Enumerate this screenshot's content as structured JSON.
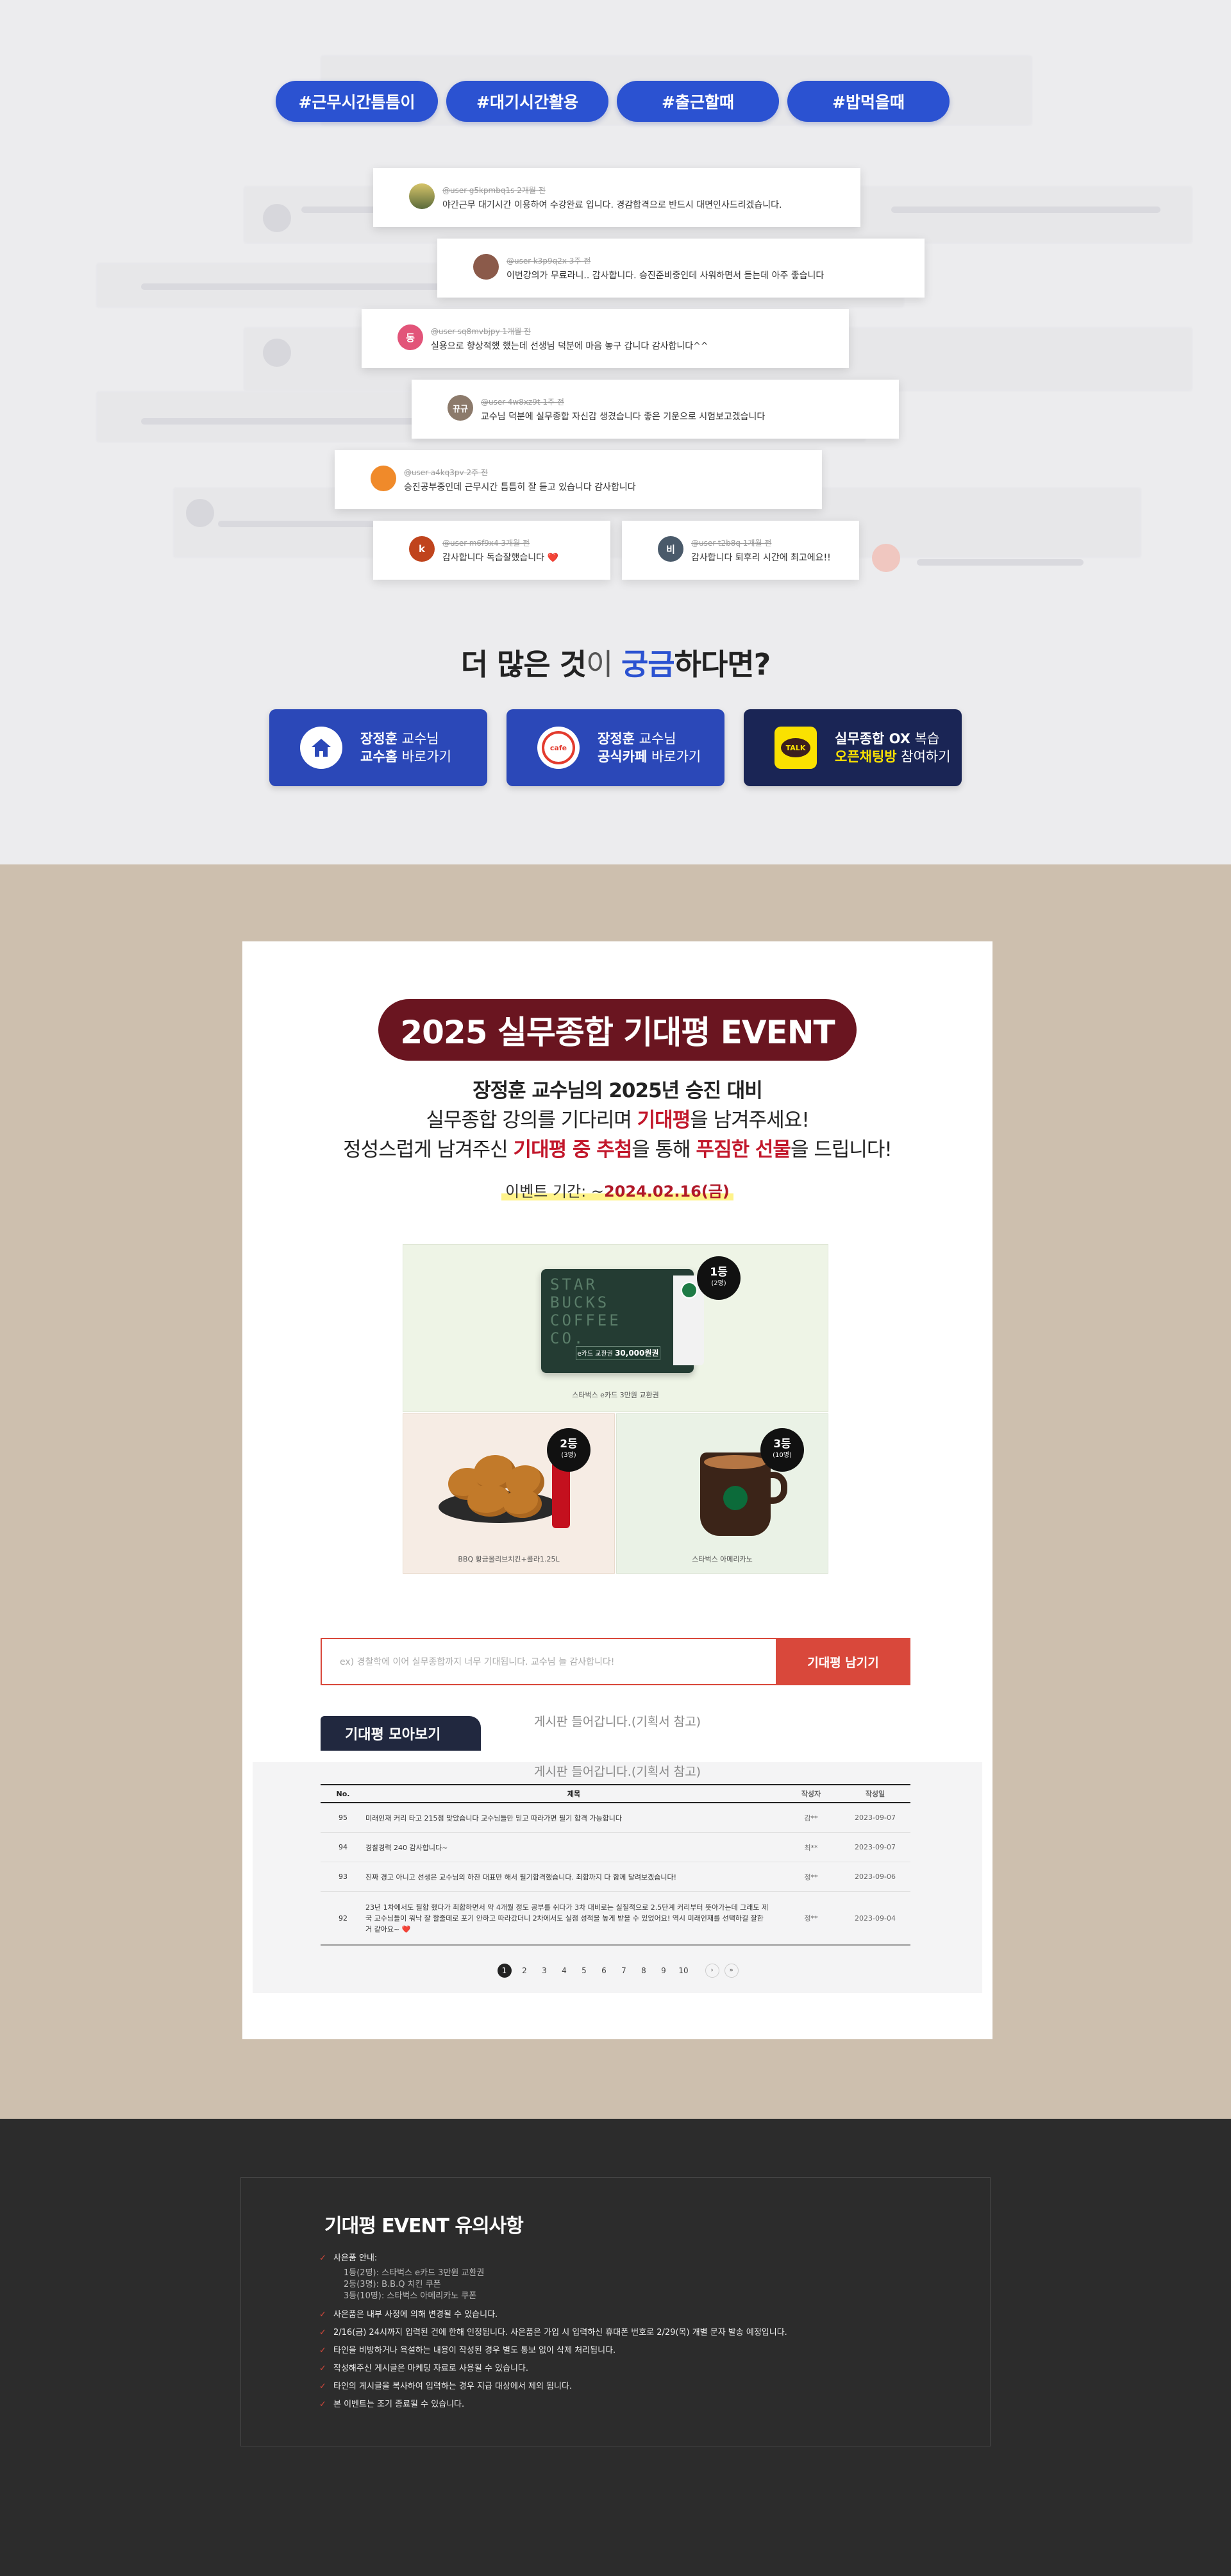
{
  "tags": [
    "#근무시간틈틈이",
    "#대기시간활용",
    "#출근할때",
    "#밥먹을때"
  ],
  "reviews": [
    {
      "user": "@user-g5kpmbq1s",
      "date": "2개월 전",
      "initial": "",
      "color": "#7a8a5a",
      "text": "야간근무 대기시간 이용하여 수강완료 입니다. 경감합격으로 반드시 대면인사드리겠습니다."
    },
    {
      "user": "@user-k3p9q2x",
      "date": "3주 전",
      "initial": "",
      "color": "#8b5a4a",
      "text": "이번강의가 무료라니.. 감사합니다. 승진준비중인데 사워하면서 듣는데 아주 좋습니다"
    },
    {
      "user": "@user-sq8mvbjpy",
      "date": "1개월 전",
      "initial": "동",
      "color": "#e25479",
      "text": "실용으로 향상적했 했는데 선생님 덕분에 마음 놓구 갑니다 감사합니다^^"
    },
    {
      "user": "@user-4w8xz9t",
      "date": "1주 전",
      "initial": "뀨규",
      "color": "#8c7a6b",
      "text": "교수님 덕분에 실무종합 자신감 생겼습니다 좋은 기운으로 시험보고겠습니다"
    },
    {
      "user": "@user-a4kq3pv",
      "date": "2주 전",
      "initial": "",
      "color": "#f08a2a",
      "text": "승진공부중인데 근무시간 틈틈히 잘 듣고 있습니다 감사합니다"
    },
    {
      "user": "@user-m6f9x4",
      "date": "3개월 전",
      "initial": "k",
      "color": "#c0441d",
      "text": "감사합니다 독습잘했습니다 ❤️"
    },
    {
      "user": "@user-t2b8q",
      "date": "1개월 전",
      "initial": "비",
      "color": "#4a5a6a",
      "text": "감사합니다 퇴후리 시간에 최고에요!!"
    }
  ],
  "more": {
    "pre": "더 많은 것",
    "mid": "이 ",
    "blue": "궁금",
    "post": "하다면?"
  },
  "links": [
    {
      "line1_a": "장정훈",
      "line1_b": " 교수님",
      "line2_a": "교수홈",
      "line2_b": " 바로가기",
      "bg": "#2b48b8"
    },
    {
      "line1_a": "장정훈",
      "line1_b": " 교수님",
      "line2_a": "공식카페",
      "line2_b": " 바로가기",
      "bg": "#2b48b8",
      "icon_text": "cafe"
    },
    {
      "line1_a": "실무종합 OX",
      "line1_b": " 복습",
      "line2_a": "오픈채팅방",
      "line2_b": " 참여하기",
      "bg": "#1a2555",
      "icon_text": "TALK"
    }
  ],
  "event": {
    "title": "2025 실무종합 기대평 EVENT",
    "line1": "장정훈 교수님의 2025년 승진 대비",
    "line2_a": "실무종합 강의를 기다리며 ",
    "line2_red": "기대평",
    "line2_b": "을 남겨주세요!",
    "line3_a": "정성스럽게 남겨주신 ",
    "line3_red1": "기대평 중 추첨",
    "line3_b": "을 통해 ",
    "line3_red2": "푸짐한 선물",
    "line3_c": "을 드립니다!",
    "period_label": "이벤트 기간: ~",
    "period_value": "2024.02.16(금)"
  },
  "prizes": [
    {
      "rank": "1등",
      "count": "(2명)",
      "caption": "스타벅스 e카드 3만원 교환권",
      "card_text": "STAR BUCKS COFFEE CO.",
      "card_value_label": "e카드 교환권",
      "card_value": "30,000원권"
    },
    {
      "rank": "2등",
      "count": "(3명)",
      "caption": "BBQ 황금올리브치킨+콜라1.25L"
    },
    {
      "rank": "3등",
      "count": "(10명)",
      "caption": "스타벅스 아메리카노"
    }
  ],
  "form": {
    "placeholder": "ex) 경찰학에 이어 실무종합까지 너무 기대됩니다. 교수님 늘 감사합니다!",
    "submit": "기대평 남기기"
  },
  "board": {
    "note1": "게시판 들어갑니다.(기획서 참고)",
    "note2": "게시판 들어갑니다.(기획서 참고)",
    "tab": "기대평 모아보기",
    "headers": [
      "No.",
      "제목",
      "작성자",
      "작성일"
    ],
    "rows": [
      {
        "no": "95",
        "title": "미래인재 커리 타고 215점 맞았습니다 교수님들만 믿고 따라가면 필기 합격 가능합니다",
        "author": "감**",
        "date": "2023-09-07"
      },
      {
        "no": "94",
        "title": "경찰경력 240 감사합니다~",
        "author": "최**",
        "date": "2023-09-07"
      },
      {
        "no": "93",
        "title": "진짜 경고 아니고 선생은 교수님의 하찬 대표만 해서 필기합격했습니다. 최합까지 다 함께 달려보겠습니다!",
        "author": "정**",
        "date": "2023-09-06"
      },
      {
        "no": "92",
        "title": "23년 1차에서도 필합 했다가 최합하면서 약 4개월 정도 공부를 쉬다가 3차 대비로는 실질적으로 2.5단계 커리부터 뜻아가는데 그래도 제국 교수님들이 워낙 잘 할줄데로 포기 안하고 따라갔더니 2차에서도 실점 성적을 높게 받을 수 있었어요! 역시 미래인재를 선택하길 잘한거 같아요~ ❤️",
        "author": "정**",
        "date": "2023-09-04"
      }
    ],
    "pages": [
      "1",
      "2",
      "3",
      "4",
      "5",
      "6",
      "7",
      "8",
      "9",
      "10"
    ],
    "next": "›",
    "last": "»"
  },
  "notice": {
    "title": "기대평 EVENT 유의사항",
    "items": [
      {
        "text": "사은품 안내:",
        "subs": [
          "1등(2명): 스타벅스 e카드 3만원 교환권",
          "2등(3명): B.B.Q 치킨 쿠폰",
          "3등(10명): 스타벅스 아메리카노 쿠폰"
        ]
      },
      {
        "text": "사은품은 내부 사정에 의해 변경될 수 있습니다."
      },
      {
        "text": "2/16(금) 24시까지 입력된 건에 한해 인정됩니다. 사은품은 가입 시 입력하신 휴대폰 번호로 2/29(목) 개별 문자 발송 예정입니다."
      },
      {
        "text": "타인을 비방하거나 욕설하는 내용이 작성된 경우 별도 통보 없이 삭제 처리됩니다."
      },
      {
        "text": "작성해주신 게시글은 마케팅 자료로 사용될 수 있습니다."
      },
      {
        "text": "타인의 게시글을 복사하여 입력하는 경우 지급 대상에서 제외 됩니다."
      },
      {
        "text": "본 이벤트는 조기 종료될 수 있습니다."
      }
    ]
  },
  "colors": {
    "blue": "#2b52d1",
    "maroon": "#6a1520",
    "red": "#d9483b",
    "beige": "#cdbfae",
    "dark": "#2c2c2c"
  }
}
